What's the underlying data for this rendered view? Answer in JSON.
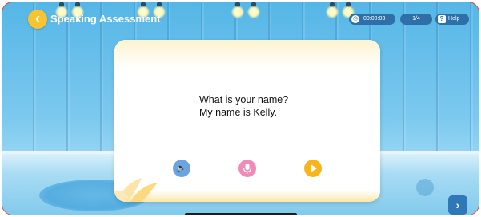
{
  "header": {
    "title": "Speaking Assessment",
    "back_icon": "chevron-left-icon"
  },
  "status": {
    "timer": "00:00:03",
    "progress": "1/4",
    "help_label": "Help"
  },
  "card": {
    "question": "What is your name?",
    "answer": "My name is Kelly."
  },
  "controls": {
    "speaker_icon": "speaker-icon",
    "mic_icon": "microphone-icon",
    "play_icon": "play-icon"
  },
  "colors": {
    "accent_yellow": "#f7c431",
    "button_blue": "#2f6fa8",
    "speaker": "#6aa4e3",
    "mic": "#f08bb7",
    "play": "#f6b51c"
  }
}
